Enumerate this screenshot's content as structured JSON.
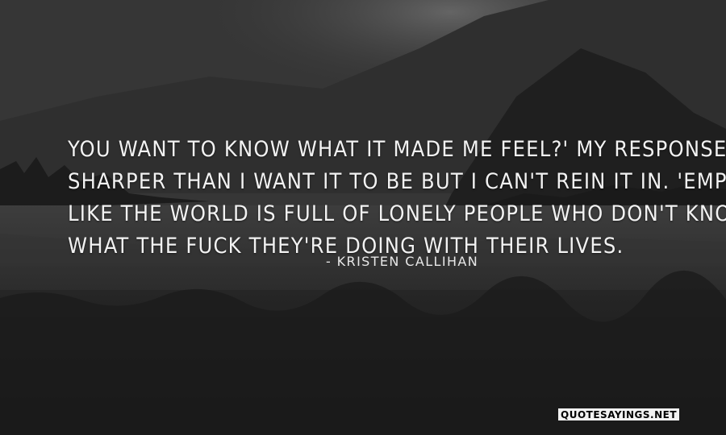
{
  "quote": {
    "lines": [
      "You want to know what it made me feel?' My response is",
      "sharper than I want it to be but I can't rein it in. 'Empty.",
      "Like the world is full of lonely people who don't know",
      "what the fuck they're doing with their lives."
    ],
    "author": "- Kristen Callihan"
  },
  "watermark": {
    "text": "QUOTESAYINGS.NET"
  },
  "colors": {
    "text": "#f2f2f2",
    "overlay": "#2a2a2a"
  }
}
